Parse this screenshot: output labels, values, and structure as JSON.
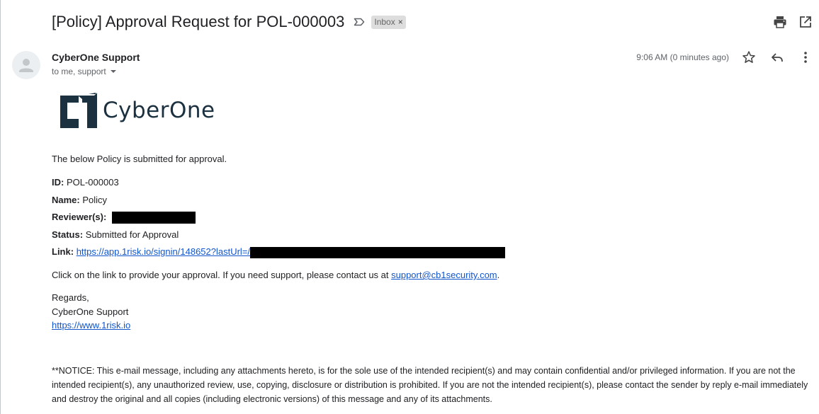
{
  "email": {
    "subject": "[Policy] Approval Request for POL-000003",
    "label_badge": "Inbox",
    "label_remove": "×",
    "sender_name": "CyberOne Support",
    "recipients": "to me, support",
    "time": "9:06 AM (0 minutes ago)"
  },
  "icons": {
    "important": "label-important-icon",
    "print": "print-icon",
    "open_new_window": "open-in-new-icon",
    "star": "star-icon",
    "reply": "reply-icon",
    "more": "more-vert-icon",
    "avatar": "person-icon"
  },
  "logo": {
    "text": "CyberOne"
  },
  "body": {
    "intro": "The below Policy is submitted for approval.",
    "id_label": "ID:",
    "id_value": "POL-000003",
    "name_label": "Name:",
    "name_value": "Policy",
    "reviewers_label": "Reviewer(s):",
    "status_label": "Status:",
    "status_value": "Submitted for Approval",
    "link_label": "Link:",
    "link_url": "https://app.1risk.io/signin/148652?lastUrl=/",
    "click_text": "Click on the link to provide your approval. If you need support, please contact us at ",
    "support_email": "support@cb1security.com",
    "click_end": ".",
    "regards": "Regards,",
    "signature": "CyberOne Support",
    "website": "https://www.1risk.io",
    "notice": "**NOTICE: This e-mail message, including any attachments hereto, is for the sole use of the intended recipient(s) and may contain confidential and/or privileged information. If you are not the intended recipient(s), any unauthorized review, use, copying, disclosure or distribution is prohibited. If you are not the intended recipient(s), please contact the sender by reply e-mail immediately and destroy the original and all copies (including electronic versions) of this message and any of its attachments."
  },
  "colors": {
    "link": "#1155cc",
    "logo": "#1c3140",
    "badge_bg": "#dddddd",
    "text": "#202124",
    "muted": "#5f6368"
  }
}
